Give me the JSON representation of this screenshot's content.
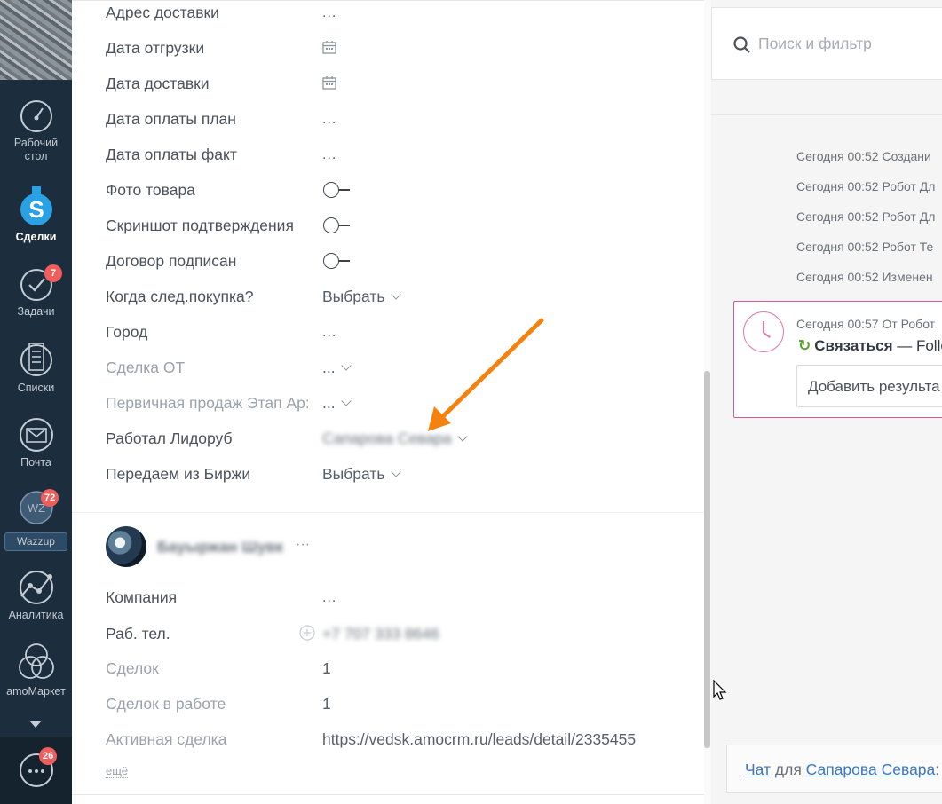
{
  "nav": {
    "items": [
      {
        "label_line1": "Рабочий",
        "label_line2": "стол"
      },
      {
        "label_line1": "Сделки",
        "label_line2": ""
      },
      {
        "label_line1": "Задачи",
        "label_line2": "",
        "badge": "7"
      },
      {
        "label_line1": "Списки",
        "label_line2": ""
      },
      {
        "label_line1": "Почта",
        "label_line2": ""
      },
      {
        "label_line1": "Wazzup",
        "label_line2": "",
        "badge": "72",
        "avatar": "WZ"
      },
      {
        "label_line1": "Аналитика",
        "label_line2": ""
      },
      {
        "label_line1": "amoМаркет",
        "label_line2": ""
      }
    ],
    "chat_badge": "26",
    "colors": {
      "background": "#1c2d3e",
      "badge": "#f05d5d"
    }
  },
  "lead_fields": [
    {
      "label": "Адрес доставки",
      "value": "..."
    },
    {
      "label": "Дата отгрузки",
      "value": "",
      "icon": "calendar-icon"
    },
    {
      "label": "Дата доставки",
      "value": "",
      "icon": "calendar-icon"
    },
    {
      "label": "Дата оплаты план",
      "value": "..."
    },
    {
      "label": "Дата оплаты факт",
      "value": "..."
    },
    {
      "label": "Фото товара",
      "value": "",
      "icon": "toggle-off"
    },
    {
      "label": "Скриншот подтверждения",
      "value": "",
      "icon": "toggle-off"
    },
    {
      "label": "Договор подписан",
      "value": "",
      "icon": "toggle-off"
    },
    {
      "label": "Когда след.покупка?",
      "value": "Выбрать"
    },
    {
      "label": "Город",
      "value": "..."
    },
    {
      "label": "Сделка ОТ",
      "value": "..."
    },
    {
      "label": "Первичная продаж Этап Ар:",
      "value": "..."
    },
    {
      "label": "Работал Лидоруб",
      "value": "Сапарова Севара"
    },
    {
      "label": "Передаем из Биржи",
      "value": "Выбрать"
    }
  ],
  "contact": {
    "name": "Бауыржан Шувк",
    "more": "···",
    "fields": [
      {
        "label": "Компания",
        "value": "..."
      },
      {
        "label": "Раб. тел.",
        "value": "+7 707 333 8646"
      },
      {
        "label": "Сделок",
        "value": "1"
      },
      {
        "label": "Сделок в работе",
        "value": "1"
      },
      {
        "label": "Активная сделка",
        "value": "https://vedsk.amocrm.ru/leads/detail/2335455"
      }
    ],
    "more_link": "ещё"
  },
  "feed": {
    "search_placeholder": "Поиск и фильтр",
    "events": [
      "Сегодня 00:52 Создани",
      "Сегодня 00:52 Робот Дл",
      "Сегодня 00:52 Робот Дл",
      "Сегодня 00:52 Робот Те",
      "Сегодня 00:52 Изменен"
    ],
    "task": {
      "meta": "Сегодня 00:57 От Робот",
      "title_bold": "Связаться",
      "title_rest": " — Follo",
      "result_placeholder": "Добавить результа"
    },
    "chat": {
      "link1": "Чат",
      "middle": " для ",
      "link2": "Сапарова Севара",
      "tail": ":"
    },
    "colors": {
      "task_border": "#d05a95",
      "link": "#3b78c6",
      "refresh": "#5aa02c"
    }
  },
  "annotation": {
    "arrow_color": "#f5820e"
  }
}
